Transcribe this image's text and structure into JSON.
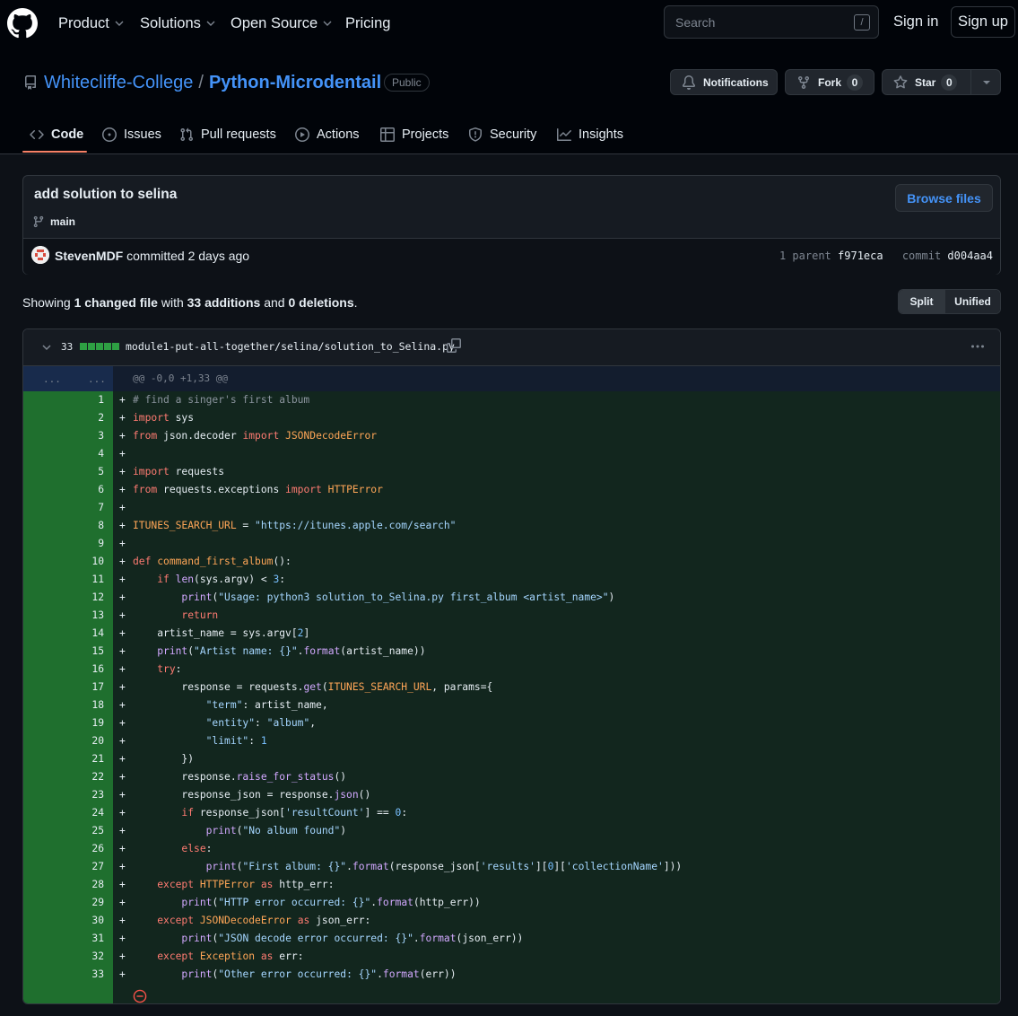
{
  "topnav": {
    "items": [
      "Product",
      "Solutions",
      "Open Source",
      "Pricing"
    ],
    "search_placeholder": "Search",
    "search_shortcut": "/",
    "sign_in": "Sign in",
    "sign_up": "Sign up"
  },
  "repo": {
    "owner": "Whitecliffe-College",
    "separator": "/",
    "name": "Python-Microdentail",
    "visibility": "Public",
    "notifications_label": "Notifications",
    "fork_label": "Fork",
    "fork_count": "0",
    "star_label": "Star",
    "star_count": "0"
  },
  "tabs": [
    "Code",
    "Issues",
    "Pull requests",
    "Actions",
    "Projects",
    "Security",
    "Insights"
  ],
  "commit": {
    "title": "add solution to selina",
    "branch": "main",
    "browse_files": "Browse files",
    "author": "StevenMDF",
    "action": "committed 2 days ago",
    "parent_label": "1 parent",
    "parent_sha": "f971eca",
    "commit_label": "commit",
    "commit_sha": "d004aa4"
  },
  "summary": {
    "prefix": "Showing",
    "changed": "1 changed file",
    "with": "with",
    "additions": "33 additions",
    "and": "and",
    "deletions": "0 deletions",
    "suffix": "."
  },
  "view_toggle": {
    "split": "Split",
    "unified": "Unified",
    "selected": "Split"
  },
  "diff": {
    "count": "33",
    "path": "module1-put-all-together/selina/solution_to_Selina.py",
    "hunk_left": "...",
    "hunk_right": "...",
    "hunk_header": "@@ -0,0 +1,33 @@",
    "marker": "+",
    "lines": [
      "# find a singer's first album",
      "import sys",
      "from json.decoder import JSONDecodeError",
      "",
      "import requests",
      "from requests.exceptions import HTTPError",
      "",
      "ITUNES_SEARCH_URL = \"https://itunes.apple.com/search\"",
      "",
      "def command_first_album():",
      "    if len(sys.argv) < 3:",
      "        print(\"Usage: python3 solution_to_Selina.py first_album <artist_name>\")",
      "        return",
      "    artist_name = sys.argv[2]",
      "    print(\"Artist name: {}\".format(artist_name))",
      "    try:",
      "        response = requests.get(ITUNES_SEARCH_URL, params={",
      "            \"term\": artist_name,",
      "            \"entity\": \"album\",",
      "            \"limit\": 1",
      "        })",
      "        response.raise_for_status()",
      "        response_json = response.json()",
      "        if response_json['resultCount'] == 0:",
      "            print(\"No album found\")",
      "        else:",
      "            print(\"First album: {}\".format(response_json['results'][0]['collectionName']))",
      "    except HTTPError as http_err:",
      "        print(\"HTTP error occurred: {}\".format(http_err))",
      "    except JSONDecodeError as json_err:",
      "        print(\"JSON decode error occurred: {}\".format(json_err))",
      "    except Exception as err:",
      "        print(\"Other error occurred: {}\".format(err))"
    ]
  },
  "colors": {
    "accent": "#4493f8",
    "tab_underline": "#f78166",
    "addition_gutter": "#1f6f2e",
    "addition_bg": "#12261e",
    "no_newline": "#f85149"
  }
}
